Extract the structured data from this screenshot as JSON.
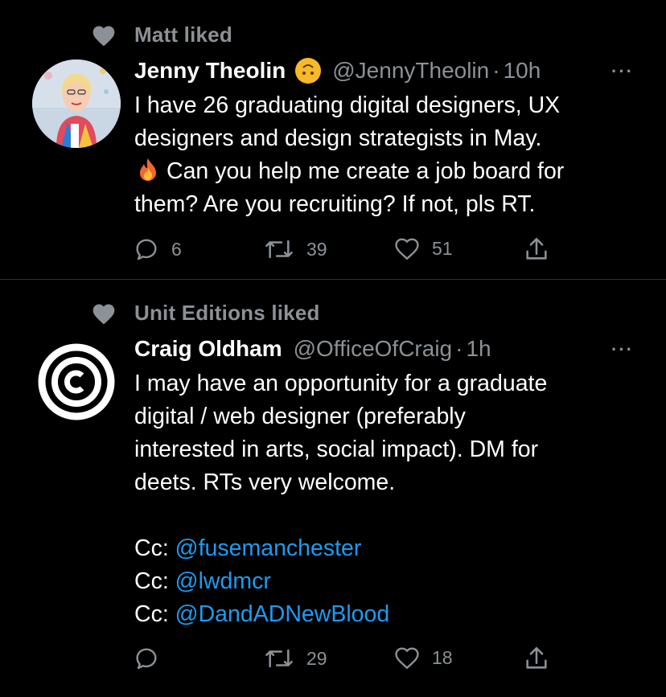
{
  "tweets": [
    {
      "social_context": "Matt liked",
      "author_name": "Jenny Theolin",
      "author_emoji": "upside-down-face-emoji",
      "handle": "@JennyTheolin",
      "dot": "·",
      "time": "10h",
      "more": "···",
      "lines": [
        "I have 26 graduating digital designers, UX",
        "designers and design strategists in May.",
        "Can you help me create a job board for",
        "them? Are you recruiting? If not, pls RT."
      ],
      "fire_icon": "fire-emoji",
      "replies": "6",
      "retweets": "39",
      "likes": "51"
    },
    {
      "social_context": "Unit Editions liked",
      "author_name": "Craig Oldham",
      "handle": "@OfficeOfCraig",
      "dot": "·",
      "time": "1h",
      "more": "···",
      "lines": [
        "I may have an opportunity for a graduate",
        "digital / web designer (preferably",
        "interested in arts, social impact). DM for",
        "deets. RTs very welcome."
      ],
      "cc_prefix": "Cc:",
      "mentions": [
        "@fusemanchester",
        "@lwdmcr",
        "@DandADNewBlood"
      ],
      "replies": "",
      "retweets": "29",
      "likes": "18"
    }
  ],
  "colors": {
    "background": "#000000",
    "text": "#ffffff",
    "secondary": "#8b9196",
    "link": "#1d9bf0",
    "divider": "#2f3336"
  }
}
